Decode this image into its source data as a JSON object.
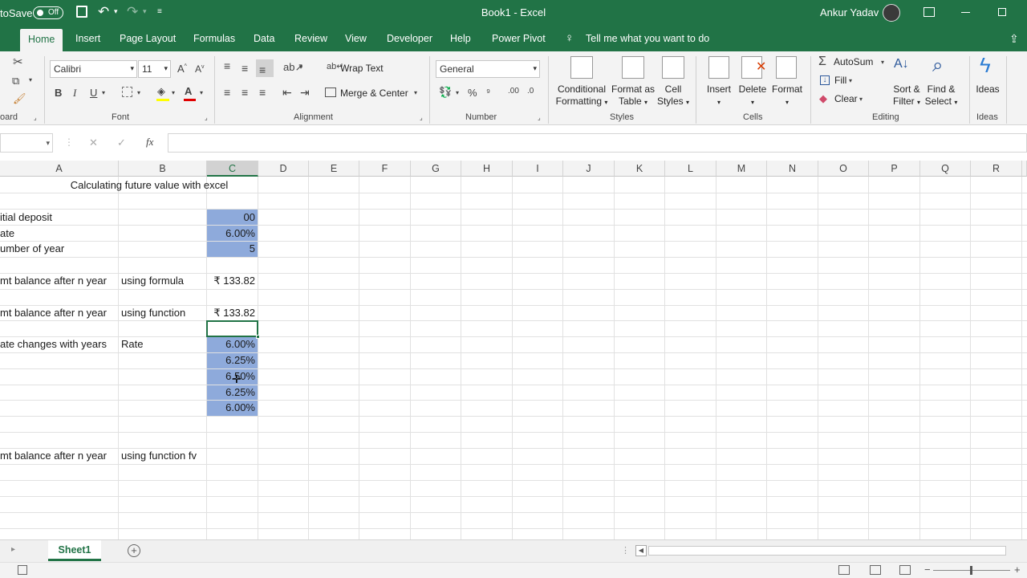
{
  "titlebar": {
    "autosave_label": "toSave",
    "autosave_state": "Off",
    "title": "Book1  -  Excel",
    "user_name": "Ankur Yadav"
  },
  "tabs": [
    "Home",
    "Insert",
    "Page Layout",
    "Formulas",
    "Data",
    "Review",
    "View",
    "Developer",
    "Help",
    "Power Pivot"
  ],
  "tell_me": "Tell me what you want to do",
  "ribbon": {
    "clipboard_label": "oard",
    "font_name": "Calibri",
    "font_size": "11",
    "font_group_label": "Font",
    "wrap_text": "Wrap Text",
    "merge_center": "Merge & Center",
    "alignment_label": "Alignment",
    "number_format": "General",
    "number_label": "Number",
    "conditional_formatting_1": "Conditional",
    "conditional_formatting_2": "Formatting",
    "format_as_table_1": "Format as",
    "format_as_table_2": "Table",
    "cell_styles_1": "Cell",
    "cell_styles_2": "Styles",
    "styles_label": "Styles",
    "insert": "Insert",
    "delete": "Delete",
    "format": "Format",
    "cells_label": "Cells",
    "autosum": "AutoSum",
    "fill": "Fill",
    "clear": "Clear",
    "sort_filter_1": "Sort &",
    "sort_filter_2": "Filter",
    "find_select_1": "Find &",
    "find_select_2": "Select",
    "editing_label": "Editing",
    "ideas": "Ideas",
    "ideas_label": "Ideas"
  },
  "formula_bar": {
    "fx": "fx",
    "cancel": "✕",
    "enter": "✓",
    "content": ""
  },
  "columns": [
    "A",
    "B",
    "C",
    "D",
    "E",
    "F",
    "G",
    "H",
    "I",
    "J",
    "K",
    "L",
    "M",
    "N",
    "O",
    "P",
    "Q",
    "R"
  ],
  "cells": {
    "title": "Calculating future value with excel",
    "a_initial": "itial deposit",
    "a_rate": "ate",
    "a_years": "umber of year",
    "a_formula": "mt balance after n year",
    "b_formula": "using formula",
    "c_formula": "₹ 133.82",
    "a_function": "mt balance after n year",
    "b_function": "using function",
    "c_function": "₹ 133.82",
    "a_changes": "ate changes with years",
    "b_rate": "Rate",
    "c_deposit": "00",
    "c_rate": "6.00%",
    "c_years": "5",
    "rates": [
      "6.00%",
      "6.25%",
      "6.50%",
      "6.25%",
      "6.00%"
    ],
    "a_fv": "mt balance after n year",
    "b_fv": "using function fv"
  },
  "sheets": {
    "active": "Sheet1"
  },
  "colors": {
    "brand": "#217346",
    "highlight": "#8eaadb"
  }
}
